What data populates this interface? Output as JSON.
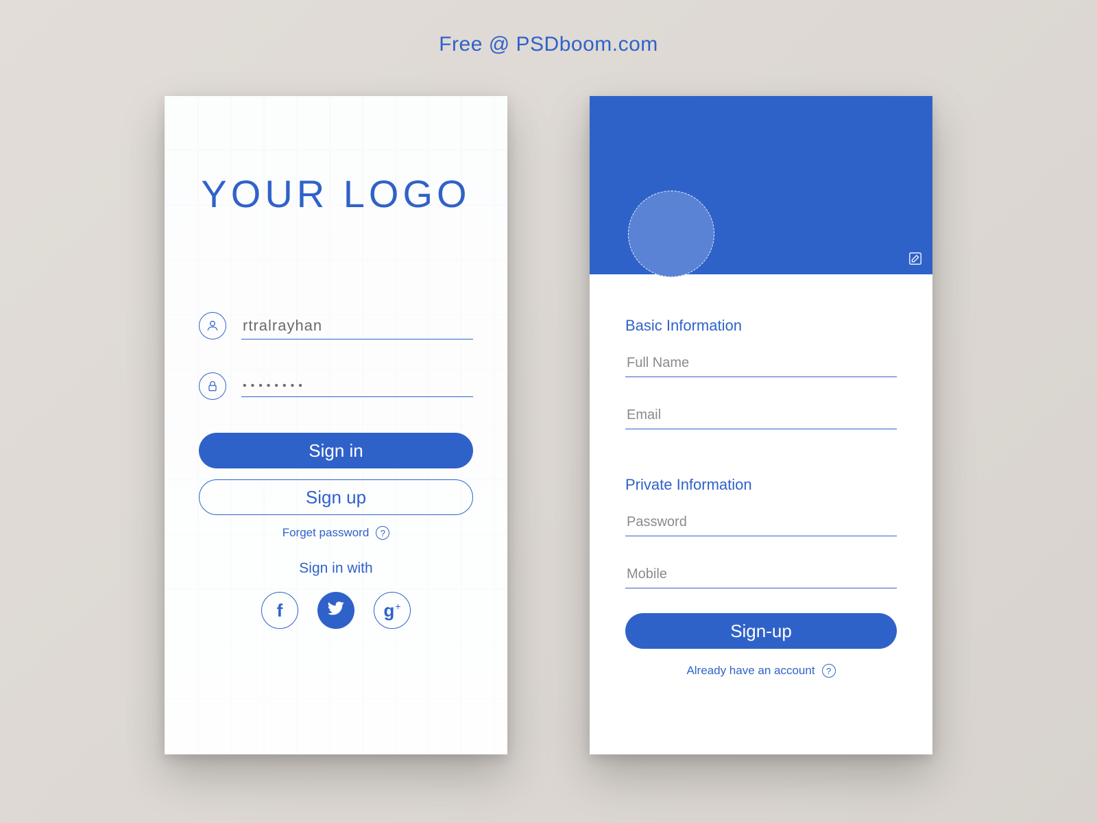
{
  "attribution": "Free @ PSDboom.com",
  "colors": {
    "primary": "#2f62c9"
  },
  "login": {
    "logo": "YOUR LOGO",
    "username_value": "rtralrayhan",
    "password_value": "••••••••",
    "signin_label": "Sign in",
    "signup_label": "Sign up",
    "forget_label": "Forget password",
    "signin_with_label": "Sign in with",
    "social": {
      "facebook": "f",
      "twitter": "twitter",
      "google": "g"
    }
  },
  "signup": {
    "section_basic": "Basic Information",
    "fullname_placeholder": "Full Name",
    "email_placeholder": "Email",
    "section_private": "Private Information",
    "password_placeholder": "Password",
    "mobile_placeholder": "Mobile",
    "signup_button": "Sign-up",
    "already_label": "Already have an account"
  }
}
